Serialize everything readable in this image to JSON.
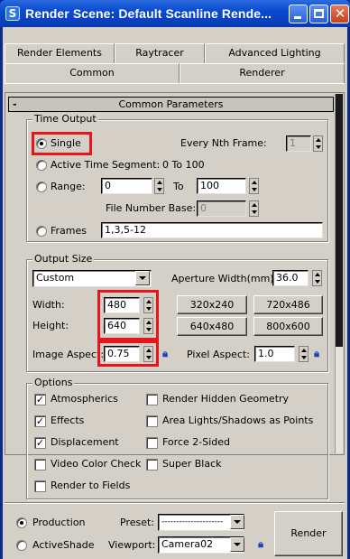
{
  "window": {
    "title": "Render Scene: Default Scanline Rende...",
    "icon": "S",
    "min_icon": "minimize-icon",
    "max_icon": "maximize-icon",
    "close_glyph": "✕"
  },
  "tabs_top": [
    "Render Elements",
    "Raytracer",
    "Advanced Lighting"
  ],
  "tabs_bottom": [
    "Common",
    "Renderer"
  ],
  "rollout": {
    "minus": "-",
    "title": "Common Parameters"
  },
  "time_output": {
    "legend": "Time Output",
    "single": "Single",
    "every_nth_label": "Every Nth Frame:",
    "every_nth_value": "1",
    "active_segment": "Active Time Segment:",
    "active_range": "0 To 100",
    "range_label": "Range:",
    "range_from": "0",
    "range_to_label": "To",
    "range_to": "100",
    "file_number_base_label": "File Number Base:",
    "file_number_base": "0",
    "frames_label": "Frames",
    "frames_value": "1,3,5-12"
  },
  "output_size": {
    "legend": "Output Size",
    "preset": "Custom",
    "aperture_label": "Aperture Width(mm):",
    "aperture_value": "36.0",
    "width_label": "Width:",
    "width_value": "480",
    "height_label": "Height:",
    "height_value": "640",
    "image_aspect_label": "Image Aspect:",
    "image_aspect_value": "0.75",
    "pixel_aspect_label": "Pixel Aspect:",
    "pixel_aspect_value": "1.0",
    "presets": [
      "320x240",
      "720x486",
      "640x480",
      "800x600"
    ]
  },
  "options": {
    "legend": "Options",
    "atmospherics": "Atmospherics",
    "render_hidden": "Render Hidden Geometry",
    "effects": "Effects",
    "area_lights": "Area Lights/Shadows as Points",
    "displacement": "Displacement",
    "force_2sided": "Force 2-Sided",
    "video_color": "Video Color Check",
    "super_black": "Super Black",
    "render_fields": "Render to Fields"
  },
  "bottom": {
    "production": "Production",
    "activeshade": "ActiveShade",
    "preset_label": "Preset:",
    "preset_value": "---------------------",
    "viewport_label": "Viewport:",
    "viewport_value": "Camera02",
    "render_button": "Render"
  },
  "colors": {
    "highlight": "#e8141b",
    "title_bar": "#0a4bd0",
    "face": "#d4d0c8"
  }
}
